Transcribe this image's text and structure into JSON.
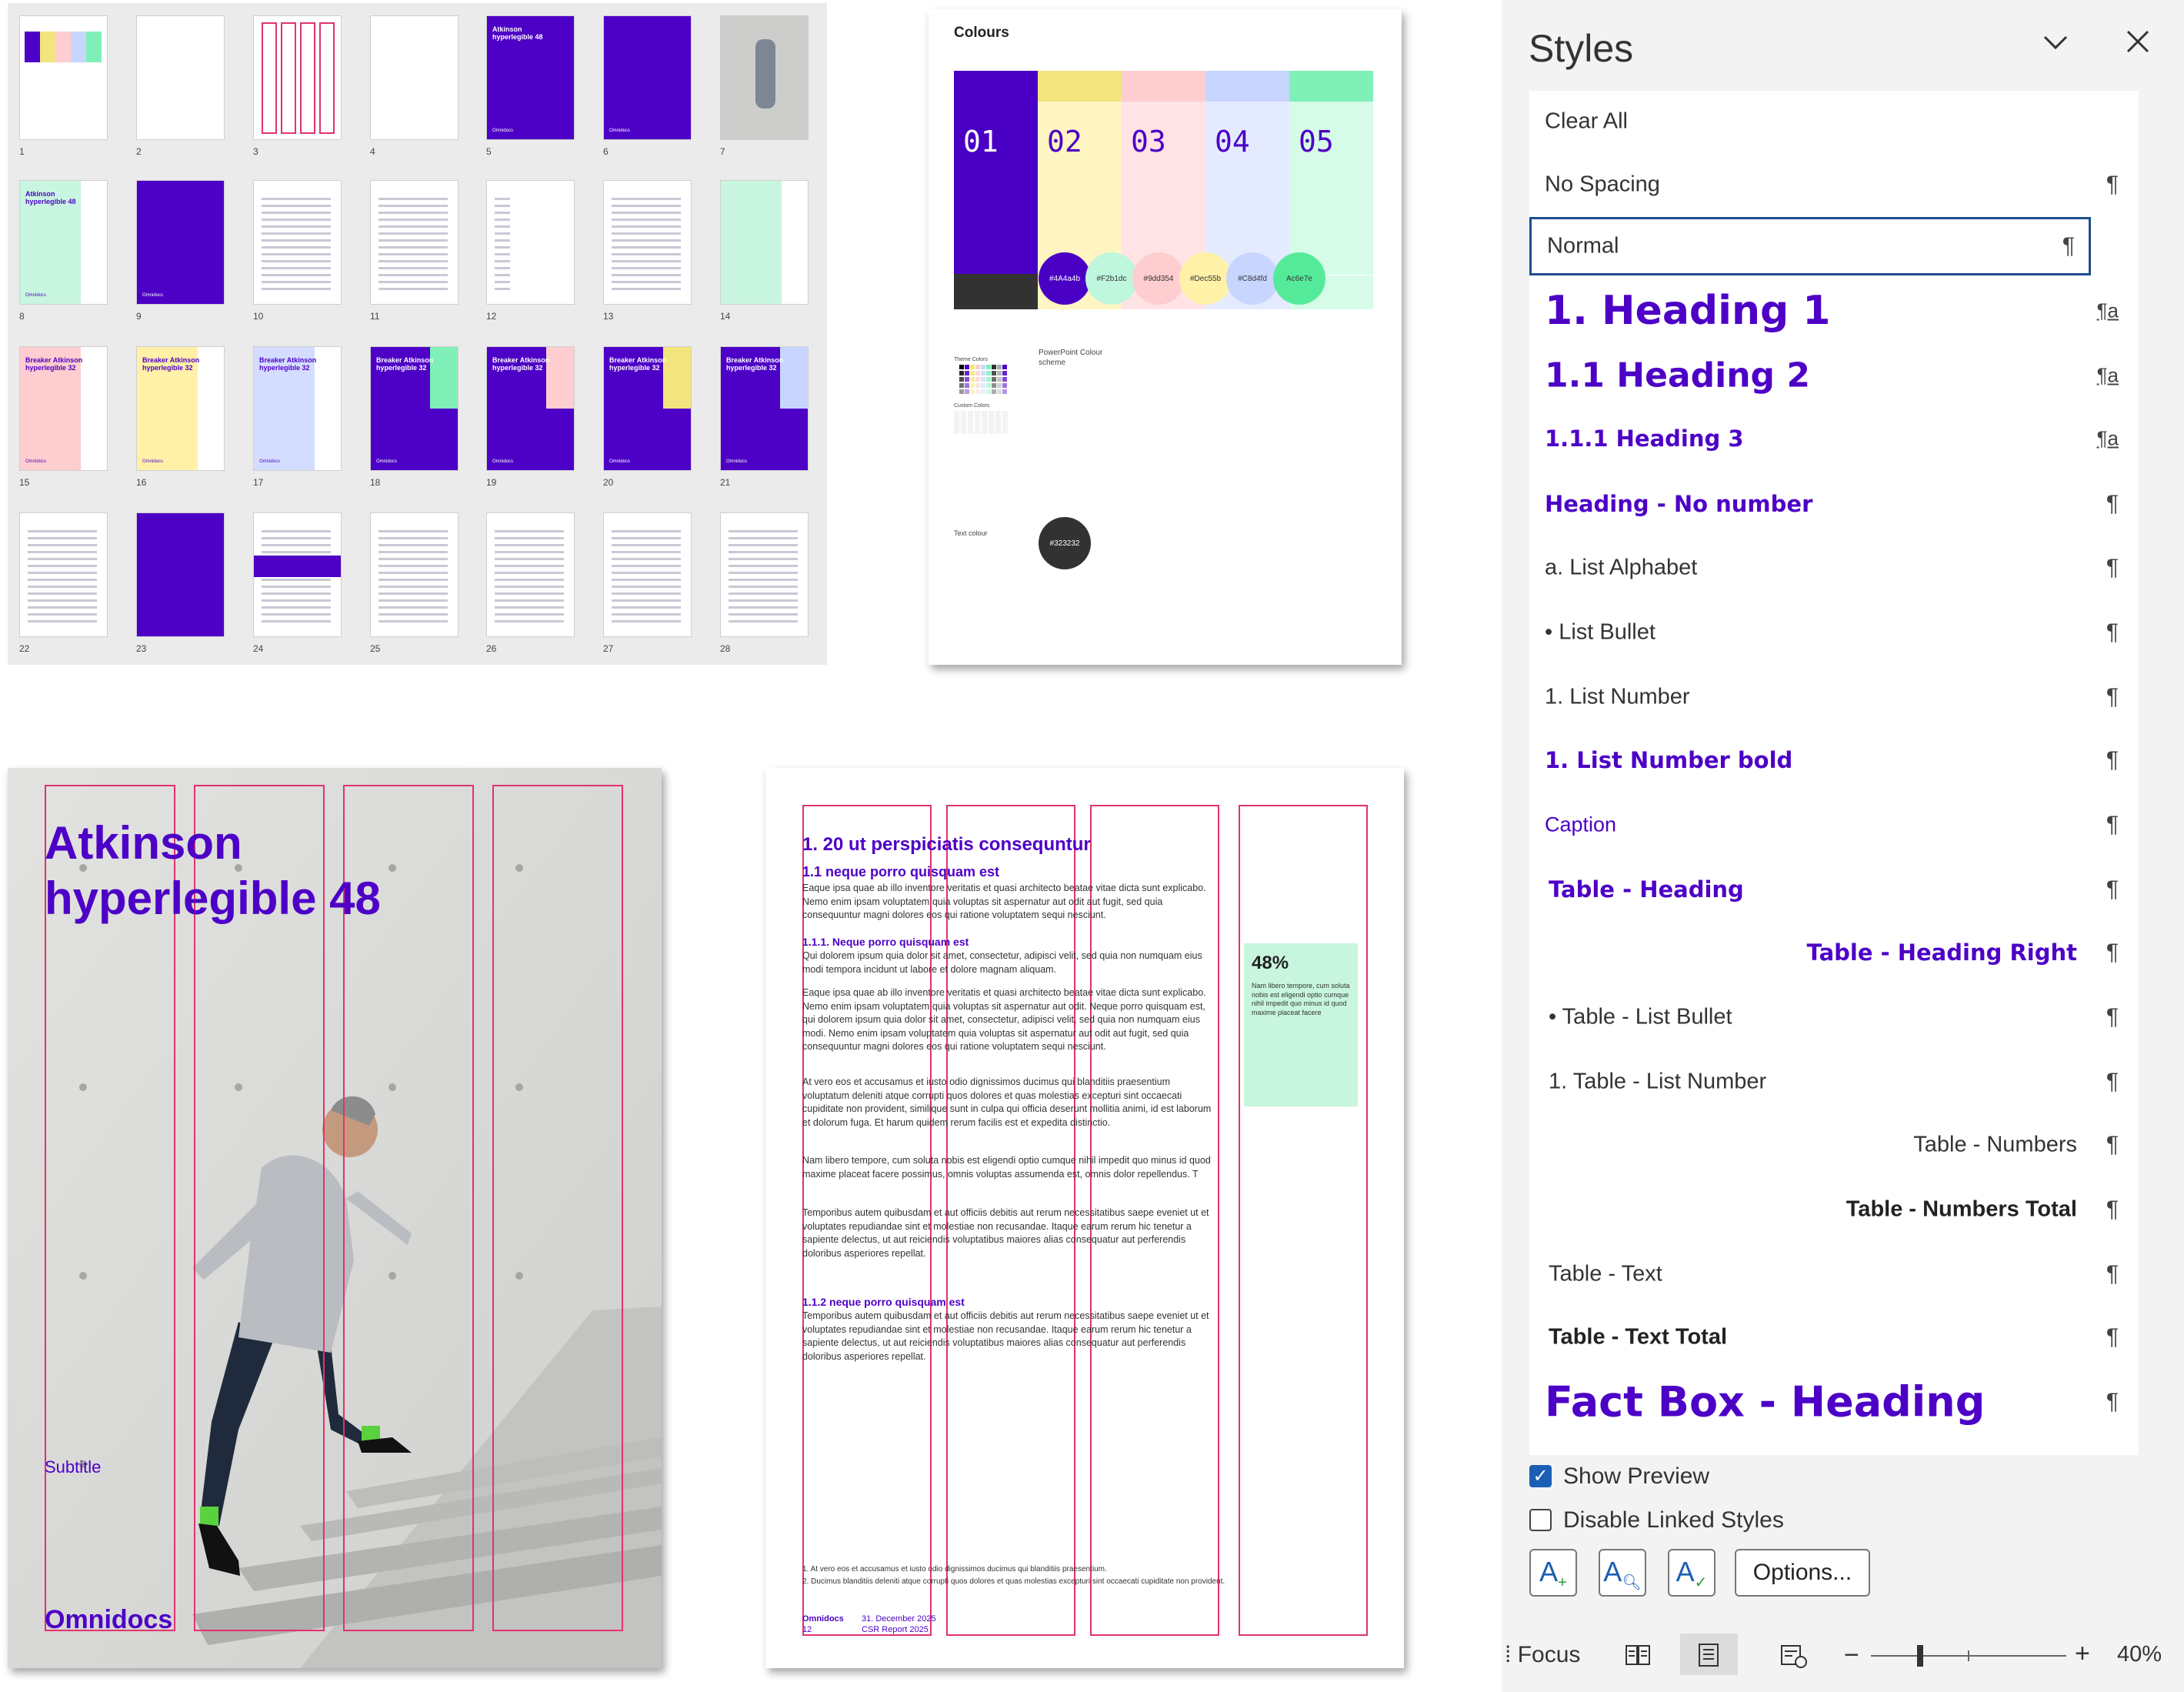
{
  "thumbnails": {
    "numbers": [
      "1",
      "2",
      "3",
      "4",
      "5",
      "6",
      "7",
      "8",
      "9",
      "10",
      "11",
      "12",
      "13",
      "14",
      "15",
      "16",
      "17",
      "18",
      "19",
      "20",
      "21",
      "22",
      "23",
      "24",
      "25",
      "26",
      "27",
      "28"
    ],
    "cover_title": "Atkinson hyperlegible 48",
    "breaker_title": "Breaker Atkinson hyperlegible 32",
    "brand": "Omnidocs"
  },
  "colours": {
    "title": "Colours",
    "numbers": [
      "01",
      "02",
      "03",
      "04",
      "05"
    ],
    "colors": [
      "#4a00c4",
      "#f2e57e",
      "#fdcdd0",
      "#c8d6ff",
      "#7ff0b8"
    ],
    "light_colors": [
      "#fff5c2",
      "#ffe3e5",
      "#e4ebff",
      "#d6fbe8"
    ],
    "theme_label": "Theme Colors",
    "custom_label": "Custom Colors",
    "ppt_label": "PowerPoint Colour scheme",
    "swatches": [
      {
        "label": "#4A4a4b",
        "color": "#4a00c4",
        "text": "#ffffff"
      },
      {
        "label": "#F2b1dc",
        "color": "#bff6de",
        "text": "#333333"
      },
      {
        "label": "#9dd354",
        "color": "#fdcdd0",
        "text": "#333333"
      },
      {
        "label": "#Dec55b",
        "color": "#fff1a8",
        "text": "#333333"
      },
      {
        "label": "#C8d4fd",
        "color": "#c8d6ff",
        "text": "#333333"
      },
      {
        "label": "Ac6e7e",
        "color": "#55ea9a",
        "text": "#333333"
      }
    ],
    "text_colour_label": "Text colour",
    "text_swatch": {
      "label": "#323232",
      "color": "#323232"
    }
  },
  "cover": {
    "title_line1": "Atkinson",
    "title_line2": "hyperlegible 48",
    "subtitle": "Subtitle",
    "brand": "Omnidocs",
    "accent": "#4d00c6",
    "grid_color": "#e0336e"
  },
  "body_page": {
    "h1": "1. 20 ut perspiciatis consequntur",
    "h2": "1.1 neque porro quisquam est",
    "p1": "Eaque ipsa quae ab illo inventore veritatis et quasi architecto beatae vitae dicta sunt explicabo. Nemo enim ipsam voluptatem quia voluptas sit aspernatur aut odit aut fugit, sed quia consequuntur magni dolores eos qui ratione voluptatem sequi nesciunt.",
    "h3": "1.1.1. Neque porro quisquam est",
    "p2": "Qui dolorem ipsum quia dolor sit amet, consectetur, adipisci velit, sed quia non numquam eius modi tempora incidunt ut labore et dolore magnam aliquam.",
    "p3": "Eaque ipsa quae ab illo inventore veritatis et quasi architecto beatae vitae dicta sunt explicabo. Nemo enim ipsam voluptatem quia voluptas sit aspernatur aut odit. Neque porro quisquam est, qui dolorem ipsum quia dolor sit amet, consectetur, adipisci velit, sed quia non numquam eius modi. Nemo enim ipsam voluptatem quia voluptas sit aspernatur aut odit aut fugit, sed quia consequuntur magni dolores eos qui ratione voluptatem sequi nesciunt.",
    "p4": "At vero eos et accusamus et iusto odio dignissimos ducimus qui blanditiis praesentium voluptatum deleniti atque corrupti quos dolores et quas molestias excepturi sint occaecati cupiditate non provident, similique sunt in culpa qui officia deserunt mollitia animi, id est laborum et dolorum fuga. Et harum quidem rerum facilis est et expedita distinctio.",
    "p5": "Nam libero tempore, cum soluta nobis est eligendi optio cumque nihil impedit quo minus id quod maxime placeat facere possimus, omnis voluptas assumenda est, omnis dolor repellendus. T",
    "p6": "Temporibus autem quibusdam et aut officiis debitis aut rerum necessitatibus saepe eveniet ut et voluptates repudiandae sint et molestiae non recusandae. Itaque earum rerum hic tenetur a sapiente delectus, ut aut reiciendis voluptatibus maiores alias consequatur aut perferendis doloribus asperiores repellat.",
    "h3b": "1.1.2 neque porro quisquam est",
    "p7": "Temporibus autem quibusdam et aut officiis debitis aut rerum necessitatibus saepe eveniet ut et voluptates repudiandae sint et molestiae non recusandae. Itaque earum rerum hic tenetur a sapiente delectus, ut aut reiciendis voluptatibus maiores alias consequatur aut perferendis doloribus asperiores repellat.",
    "fact_value": "48%",
    "fact_text": "Nam libero tempore, cum soluta nobis est eligendi optio cumque nihil impedit quo minus id quod maxime placeat facere",
    "footnote1": "1.   At vero eos et accusamus et iusto odio dignissimos ducimus qui blanditiis praesentium.",
    "footnote2": "2.   Ducimus blanditiis deleniti atque corrupti quos dolores et quas molestias excepturi sint occaecati cupiditate non provident.",
    "footer_brand": "Omnidocs",
    "footer_page": "12",
    "footer_date": "31. December 2025",
    "footer_report": "CSR Report 2025"
  },
  "styles_pane": {
    "title": "Styles",
    "items": [
      {
        "label": "Clear All",
        "mark": ""
      },
      {
        "label": "No Spacing",
        "mark": "¶"
      },
      {
        "label": "Normal",
        "mark": "¶"
      },
      {
        "label": "1.  Heading 1",
        "mark": "¶a"
      },
      {
        "label": "1.1  Heading 2",
        "mark": "¶a"
      },
      {
        "label": "1.1.1  Heading 3",
        "mark": "¶a"
      },
      {
        "label": "Heading - No number",
        "mark": "¶"
      },
      {
        "label": "a.  List Alphabet",
        "mark": "¶"
      },
      {
        "label": "•  List Bullet",
        "mark": "¶"
      },
      {
        "label": "1.  List Number",
        "mark": "¶"
      },
      {
        "label": "1.  List Number bold",
        "mark": "¶"
      },
      {
        "label": "Caption",
        "mark": "¶"
      },
      {
        "label": "Table - Heading",
        "mark": "¶"
      },
      {
        "label": "Table - Heading Right",
        "mark": "¶"
      },
      {
        "label": "•  Table - List Bullet",
        "mark": "¶"
      },
      {
        "label": "1.  Table - List Number",
        "mark": "¶"
      },
      {
        "label": "Table - Numbers",
        "mark": "¶"
      },
      {
        "label": "Table - Numbers Total",
        "mark": "¶"
      },
      {
        "label": "Table - Text",
        "mark": "¶"
      },
      {
        "label": "Table - Text Total",
        "mark": "¶"
      },
      {
        "label": "Fact Box - Heading",
        "mark": "¶"
      }
    ],
    "show_preview": "Show Preview",
    "disable_linked": "Disable Linked Styles",
    "options_button": "Options..."
  },
  "status_bar": {
    "focus": "Focus",
    "zoom": "40%",
    "zoom_fraction": 0.4
  },
  "accent": "#4d00c6"
}
